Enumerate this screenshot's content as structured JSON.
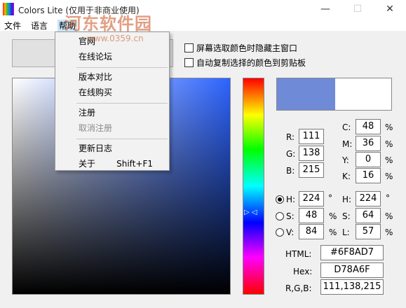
{
  "window": {
    "title": "Colors Lite (仅用于非商业使用)",
    "minimize": "—",
    "maximize": "☐",
    "close": "✕"
  },
  "menubar": {
    "file": "文件",
    "language": "语言",
    "help": "帮助"
  },
  "watermark": {
    "text": "河东软件园",
    "url": "www.0359.cn"
  },
  "options": {
    "hide_main_window": "屏幕选取颜色时隐藏主窗口",
    "auto_copy": "自动复制选择的颜色到剪贴板"
  },
  "help_menu": {
    "official_site": "官网",
    "forum": "在线论坛",
    "version_compare": "版本对比",
    "buy_online": "在线购买",
    "register": "注册",
    "unregister": "取消注册",
    "changelog": "更新日志",
    "about": "关于",
    "about_shortcut": "Shift+F1"
  },
  "color": {
    "preview_hex": "#6F8AD7",
    "hue_marker": "▷ ◁",
    "rgb": {
      "r_label": "R:",
      "r": "111",
      "g_label": "G:",
      "g": "138",
      "b_label": "B:",
      "b": "215"
    },
    "cmyk": {
      "c_label": "C:",
      "c": "48",
      "m_label": "M:",
      "m": "36",
      "y_label": "Y:",
      "y": "0",
      "k_label": "K:",
      "k": "16",
      "unit": "%"
    },
    "hsv": {
      "h_label": "H:",
      "h": "224",
      "h_unit": "°",
      "s_label": "S:",
      "s": "48",
      "s_unit": "%",
      "v_label": "V:",
      "v": "84",
      "v_unit": "%"
    },
    "hsl": {
      "h_label": "H:",
      "h": "224",
      "h_unit": "°",
      "s_label": "S:",
      "s": "64",
      "s_unit": "%",
      "l_label": "L:",
      "l": "57",
      "l_unit": "%"
    },
    "codes": {
      "html_label": "HTML:",
      "html": "#6F8AD7",
      "hex_label": "Hex:",
      "hex": "D78A6F",
      "rgb_label": "R,G,B:",
      "rgb": "111,138,215"
    }
  }
}
